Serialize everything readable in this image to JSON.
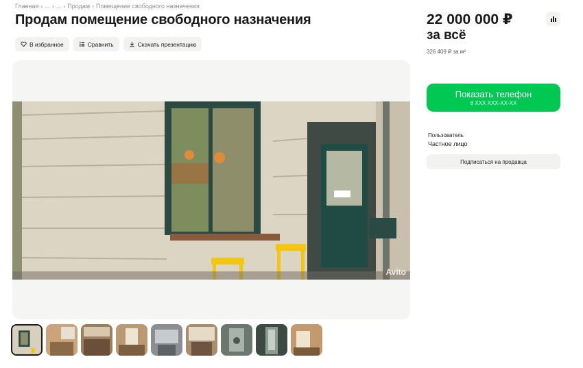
{
  "breadcrumb": {
    "items": [
      "Главная",
      "...",
      "...",
      "Продам",
      "Помещение свободного назначения"
    ]
  },
  "title": "Продам помещение свободного назначения",
  "actions": {
    "favorite_label": "В избранное",
    "compare_label": "Сравнить",
    "download_label": "Скачать презентацию"
  },
  "gallery": {
    "watermark": "Avito",
    "thumbnail_count": 9,
    "active_index": 0
  },
  "price": {
    "value": "22 000 000 ₽",
    "qualifier": "за всё",
    "per_sqm": "326 409 ₽ за м²"
  },
  "contact": {
    "show_phone_label": "Показать телефон",
    "phone_mask": "8 XXX XXX-XX-XX"
  },
  "seller": {
    "role": "Пользователь",
    "type": "Частное лицо",
    "subscribe_label": "Подписаться на продавца"
  },
  "colors": {
    "accent_green": "#00c853",
    "button_gray": "#f2f2f0"
  }
}
